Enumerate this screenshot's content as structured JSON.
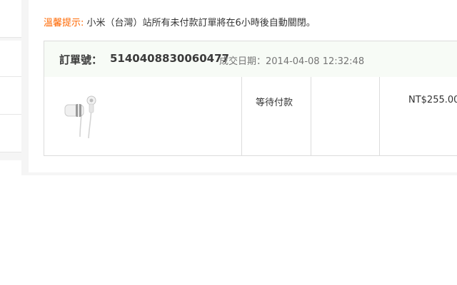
{
  "notice": {
    "label": "溫馨提示:",
    "text": " 小米（台灣）站所有未付款訂單將在6小時後自動關閉。"
  },
  "order": {
    "number_label": "訂單號：",
    "number": "5140408830060477",
    "date_label": "成交日期：",
    "date": "2014-04-08 12:32:48"
  },
  "item": {
    "image_icon": "earphones-icon",
    "status": "等待付款",
    "price": "NT$255.00"
  },
  "colors": {
    "accent": "#ff6700",
    "header_bg": "#f7fbf6",
    "border": "#dcdcdc"
  }
}
